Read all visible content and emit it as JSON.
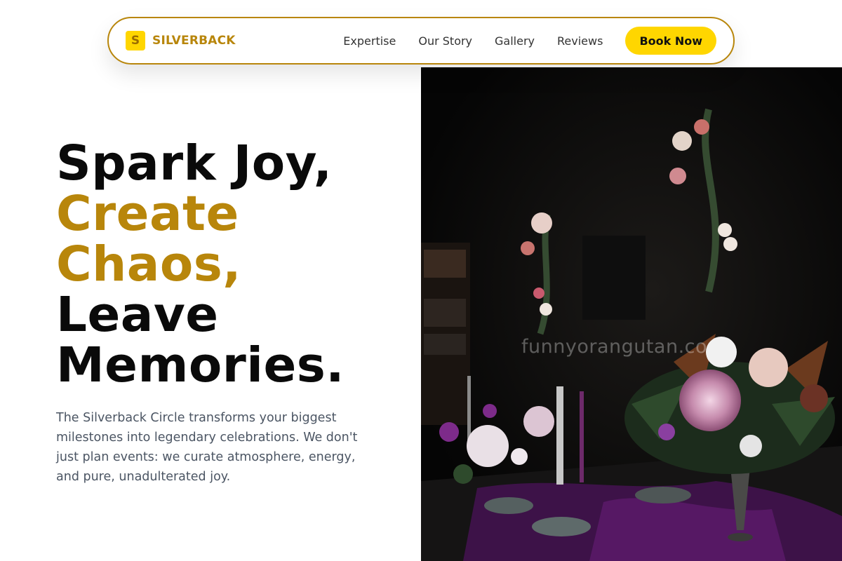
{
  "brand": {
    "mark": "S",
    "name": "SILVERBACK"
  },
  "nav": {
    "links": [
      "Expertise",
      "Our Story",
      "Gallery",
      "Reviews"
    ],
    "cta": "Book Now"
  },
  "hero": {
    "title_lines": [
      "Spark Joy,",
      "Create",
      "Chaos,",
      "Leave",
      "Memories."
    ],
    "description": "The Silverback Circle transforms your biggest milestones into legendary celebrations. We don't just plan events: we curate atmosphere, energy, and pure, unadulterated joy.",
    "image_watermark": "funnyorangutan.co"
  },
  "colors": {
    "accent_gold": "#b8860b",
    "button_yellow": "#ffd600",
    "title_black": "#0a0a0a",
    "body_gray": "#4b5563"
  }
}
